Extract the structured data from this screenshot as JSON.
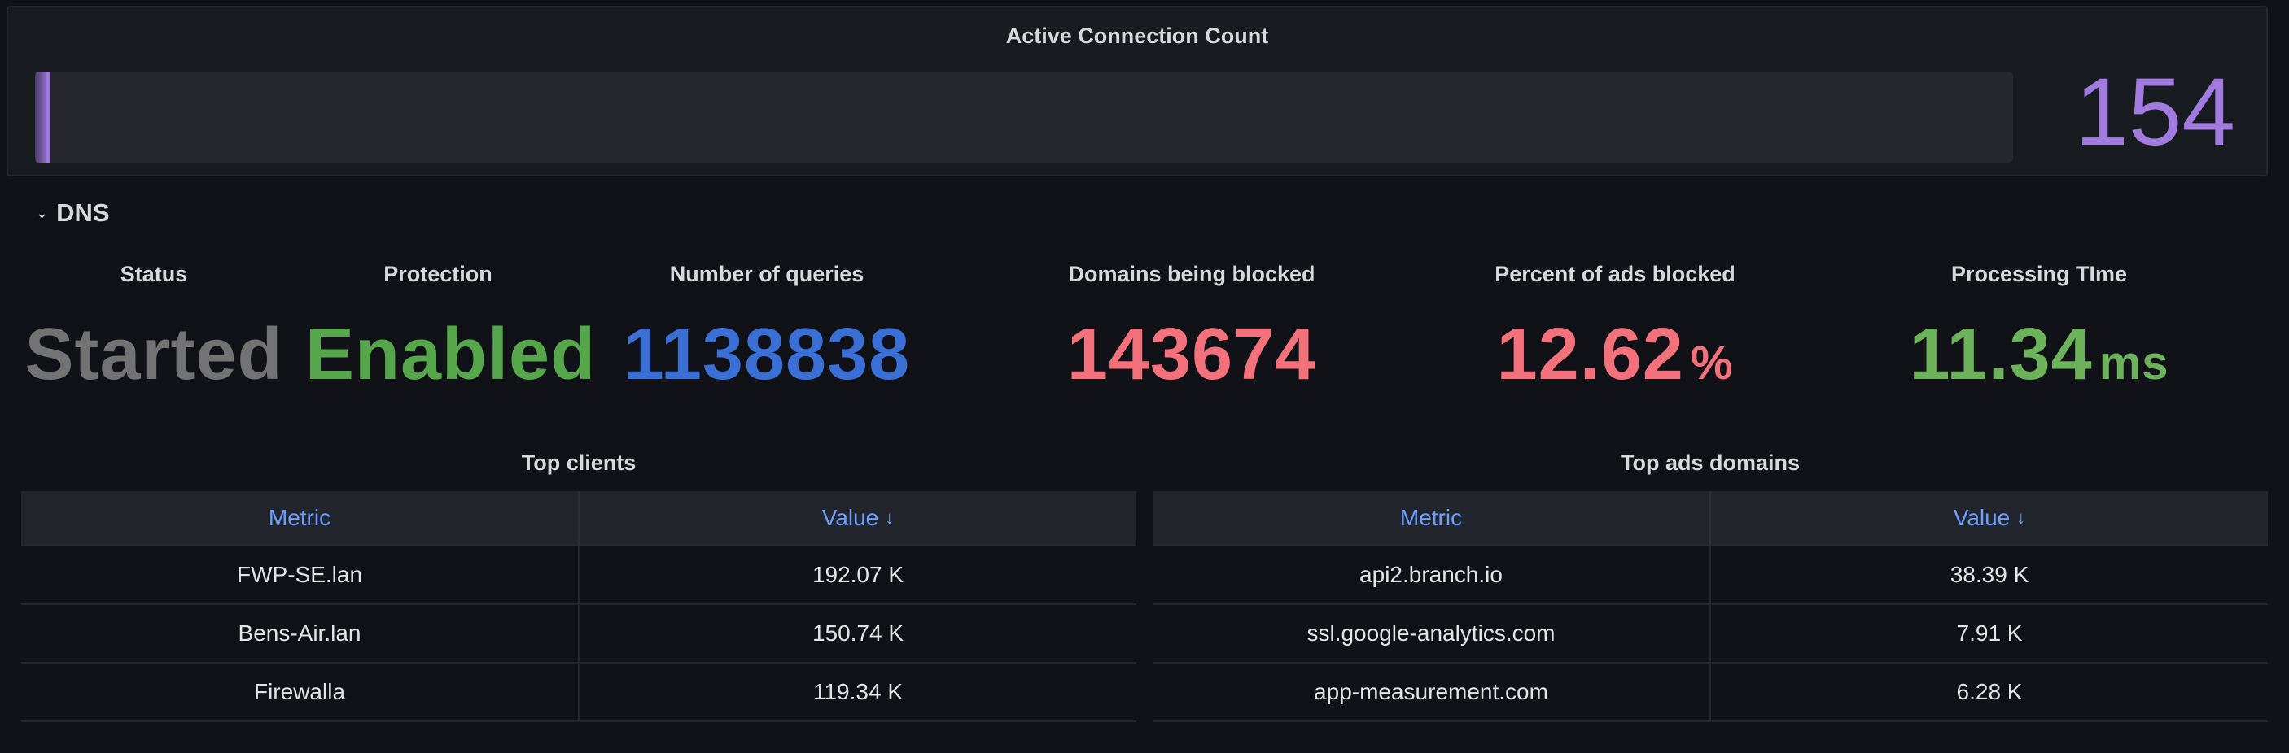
{
  "connections": {
    "title": "Active Connection Count",
    "value": "154",
    "fill_fraction": 0.008,
    "color": "#a27be0"
  },
  "dns_row": {
    "title": "DNS"
  },
  "stats": [
    {
      "title": "Status",
      "value": "Started",
      "unit": "",
      "color": "#737373"
    },
    {
      "title": "Protection",
      "value": "Enabled",
      "unit": "",
      "color": "#56a64b"
    },
    {
      "title": "Number of queries",
      "value": "1138838",
      "unit": "",
      "color": "#3a6fd6"
    },
    {
      "title": "Domains being blocked",
      "value": "143674",
      "unit": "",
      "color": "#f2717b"
    },
    {
      "title": "Percent of ads blocked",
      "value": "12.62",
      "unit": "%",
      "color": "#f2717b"
    },
    {
      "title": "Processing TIme",
      "value": "11.34",
      "unit": "ms",
      "color": "#6bb25a"
    }
  ],
  "top_clients": {
    "title": "Top clients",
    "headers": [
      "Metric",
      "Value"
    ],
    "rows": [
      [
        "FWP-SE.lan",
        "192.07 K"
      ],
      [
        "Bens-Air.lan",
        "150.74 K"
      ],
      [
        "Firewalla",
        "119.34 K"
      ]
    ]
  },
  "top_ads_domains": {
    "title": "Top ads domains",
    "headers": [
      "Metric",
      "Value"
    ],
    "rows": [
      [
        "api2.branch.io",
        "38.39 K"
      ],
      [
        "ssl.google-analytics.com",
        "7.91 K"
      ],
      [
        "app-measurement.com",
        "6.28 K"
      ]
    ]
  },
  "icons": {
    "row_collapse": "chevron-down-icon",
    "sort": "arrow-down-icon"
  }
}
